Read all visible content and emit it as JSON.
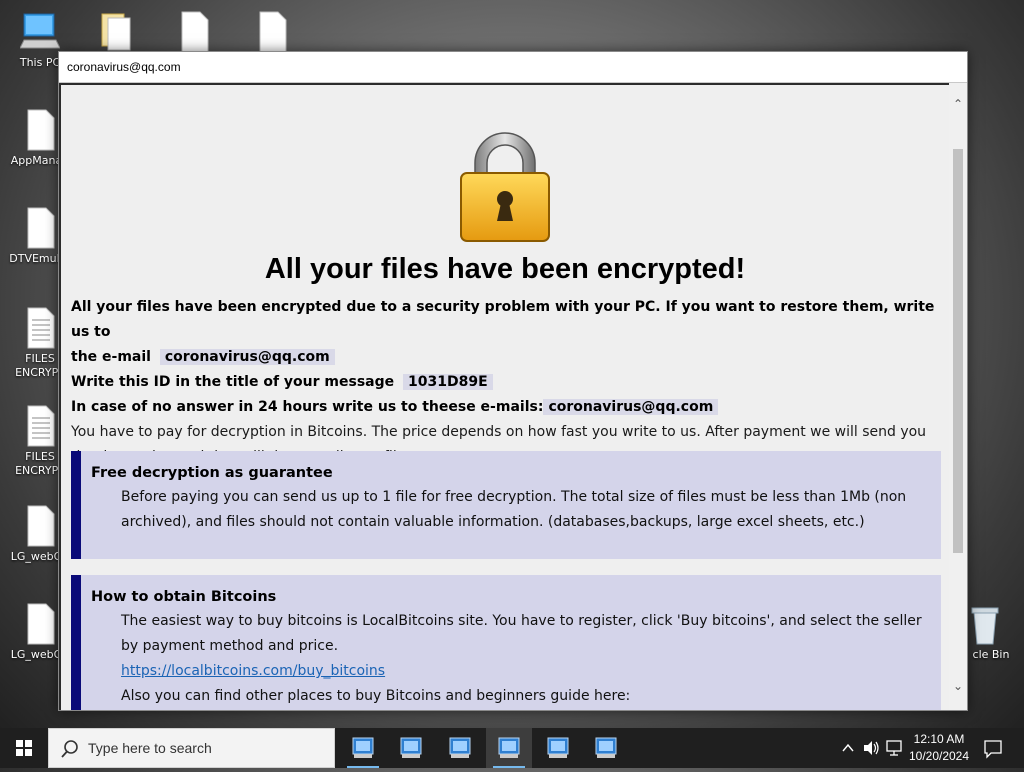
{
  "desktop": {
    "icons": [
      {
        "label": "This PC"
      },
      {
        "label": "AppManag"
      },
      {
        "label": "DTVEmulat"
      },
      {
        "label": "FILES\nENCRYPT"
      },
      {
        "label": "FILES\nENCRYPT"
      },
      {
        "label": "LG_webOS"
      },
      {
        "label": "LG_webOS"
      },
      {
        "label": "cle Bin"
      }
    ]
  },
  "window": {
    "title": "coronavirus@qq.com",
    "headline": "All your files have been encrypted!",
    "line1_a": "All your files have been encrypted due to a security problem with your PC. If you want to restore them, write us to",
    "line1_b": "the e-mail",
    "email": "coronavirus@qq.com",
    "line2": "Write this ID in the title of your message",
    "id": "1031D89E",
    "line3": "In case of no answer in 24 hours write us to theese e-mails:",
    "email2": "coronavirus@qq.com",
    "line4": "You have to pay for decryption in Bitcoins. The price depends on how fast you write to us. After payment we will send you the decryption tool that will decrypt all your files.",
    "box1": {
      "title": "Free decryption as guarantee",
      "text": "Before paying you can send us up to 1 file for free decryption. The total size of files must be less than 1Mb (non archived), and files should not contain valuable information. (databases,backups, large excel sheets, etc.)"
    },
    "box2": {
      "title": "How to obtain Bitcoins",
      "text": "The easiest way to buy bitcoins is LocalBitcoins site. You have to register, click 'Buy bitcoins', and select the seller by payment method and price.",
      "link": "https://localbitcoins.com/buy_bitcoins",
      "text2": "Also you can find other places to buy Bitcoins and beginners guide here:"
    }
  },
  "taskbar": {
    "search_placeholder": "Type here to search",
    "time": "12:10 AM",
    "date": "10/20/2024",
    "accent": "#76b9ed"
  }
}
